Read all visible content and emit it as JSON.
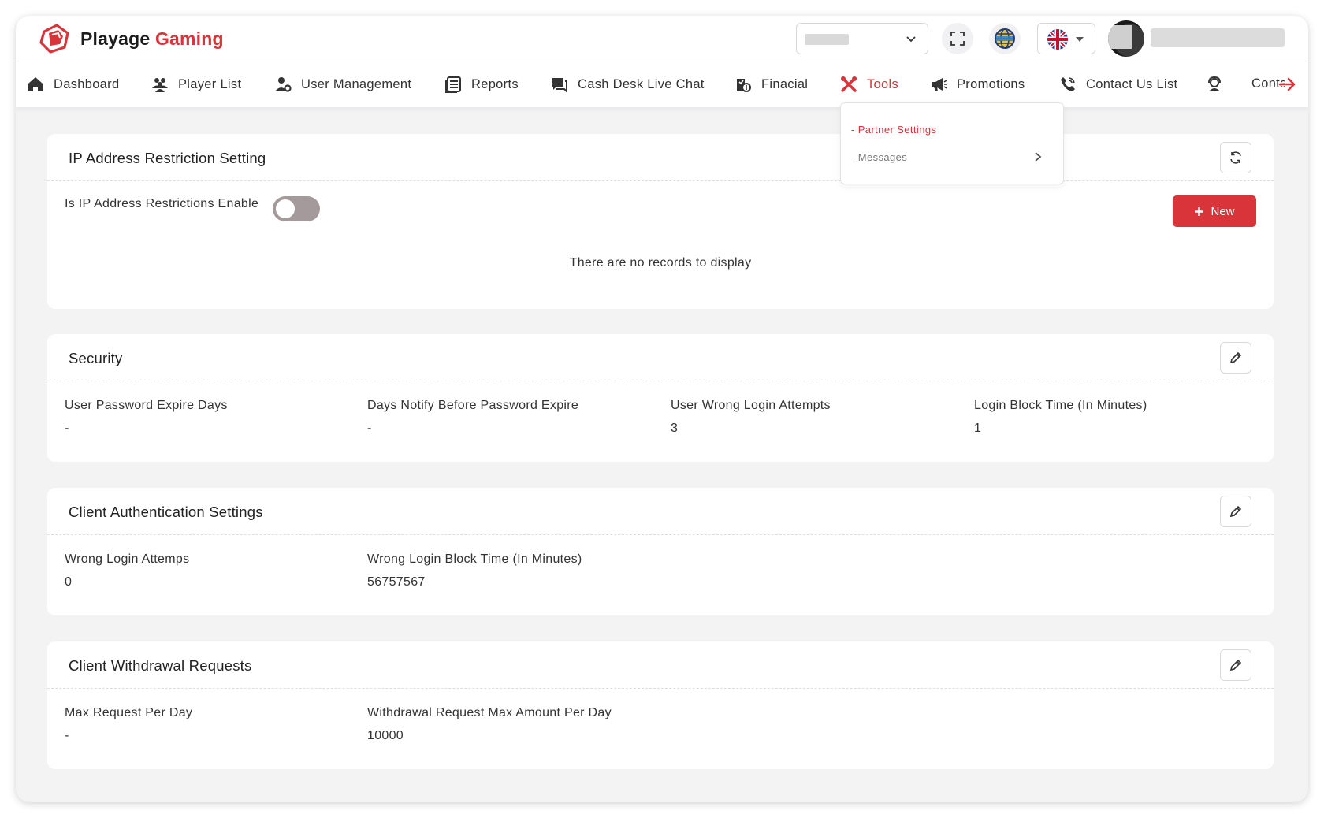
{
  "brand": {
    "name_part1": "Playage",
    "name_part2": "Gaming",
    "accent": "#d8343a"
  },
  "header": {
    "site_select_value": "",
    "icons": [
      "chevron-down-icon",
      "fullscreen-icon",
      "globe-icon",
      "uk-flag-icon"
    ]
  },
  "nav": {
    "items": [
      {
        "label": "Dashboard",
        "icon": "home-icon"
      },
      {
        "label": "Player List",
        "icon": "users-icon"
      },
      {
        "label": "User Management",
        "icon": "user-gear-icon"
      },
      {
        "label": "Reports",
        "icon": "reports-icon"
      },
      {
        "label": "Cash Desk Live Chat",
        "icon": "chat-icon"
      },
      {
        "label": "Finacial",
        "icon": "finance-icon"
      },
      {
        "label": "Tools",
        "icon": "tools-icon"
      },
      {
        "label": "Promotions",
        "icon": "megaphone-icon"
      },
      {
        "label": "Contact Us List",
        "icon": "phone-icon"
      },
      {
        "label": "Conta",
        "icon": "support-icon"
      }
    ],
    "active": "Tools"
  },
  "dropdown": {
    "items": [
      {
        "label": "- Partner Settings"
      },
      {
        "label": "- Messages"
      }
    ]
  },
  "ip_card": {
    "title": "IP Address Restriction Setting",
    "toggle_label": "Is IP Address Restrictions Enable",
    "toggle_on": false,
    "new_label": "New",
    "empty_text": "There are no records to display"
  },
  "security_card": {
    "title": "Security",
    "fields": [
      {
        "label": "User Password Expire Days",
        "value": "-"
      },
      {
        "label": "Days Notify Before Password Expire",
        "value": "-"
      },
      {
        "label": "User Wrong Login Attempts",
        "value": "3"
      },
      {
        "label": "Login Block Time (In Minutes)",
        "value": "1"
      }
    ]
  },
  "client_auth_card": {
    "title": "Client Authentication Settings",
    "fields": [
      {
        "label": "Wrong Login Attemps",
        "value": "0"
      },
      {
        "label": "Wrong Login Block Time (In Minutes)",
        "value": "56757567"
      }
    ]
  },
  "withdrawal_card": {
    "title": "Client Withdrawal Requests",
    "fields": [
      {
        "label": "Max Request Per Day",
        "value": "-"
      },
      {
        "label": "Withdrawal Request Max Amount Per Day",
        "value": "10000"
      }
    ]
  }
}
